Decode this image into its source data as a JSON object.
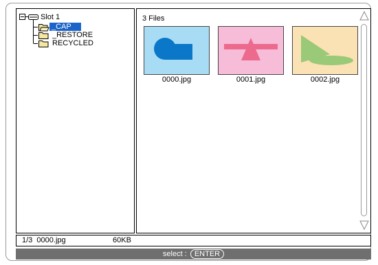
{
  "tree": {
    "root_label": "Slot 1",
    "folders": [
      {
        "label": "_CAP",
        "selected": true
      },
      {
        "label": "_RESTORE",
        "selected": false
      },
      {
        "label": "RECYCLED",
        "selected": false
      }
    ]
  },
  "files_panel": {
    "count_label": "3 Files",
    "thumbnails": [
      {
        "filename": "0000.jpg",
        "bg": "#a8dcf4"
      },
      {
        "filename": "0001.jpg",
        "bg": "#f7bcd8"
      },
      {
        "filename": "0002.jpg",
        "bg": "#fbe2b4"
      }
    ]
  },
  "status": {
    "position": "1/3",
    "filename": "0000.jpg",
    "size": "60KB"
  },
  "hint": {
    "prefix": "select :",
    "key": "ENTER"
  },
  "colors": {
    "selection": "#1c64c8",
    "hint_bar": "#6f6f6f",
    "folder": "#f5e6a0"
  }
}
